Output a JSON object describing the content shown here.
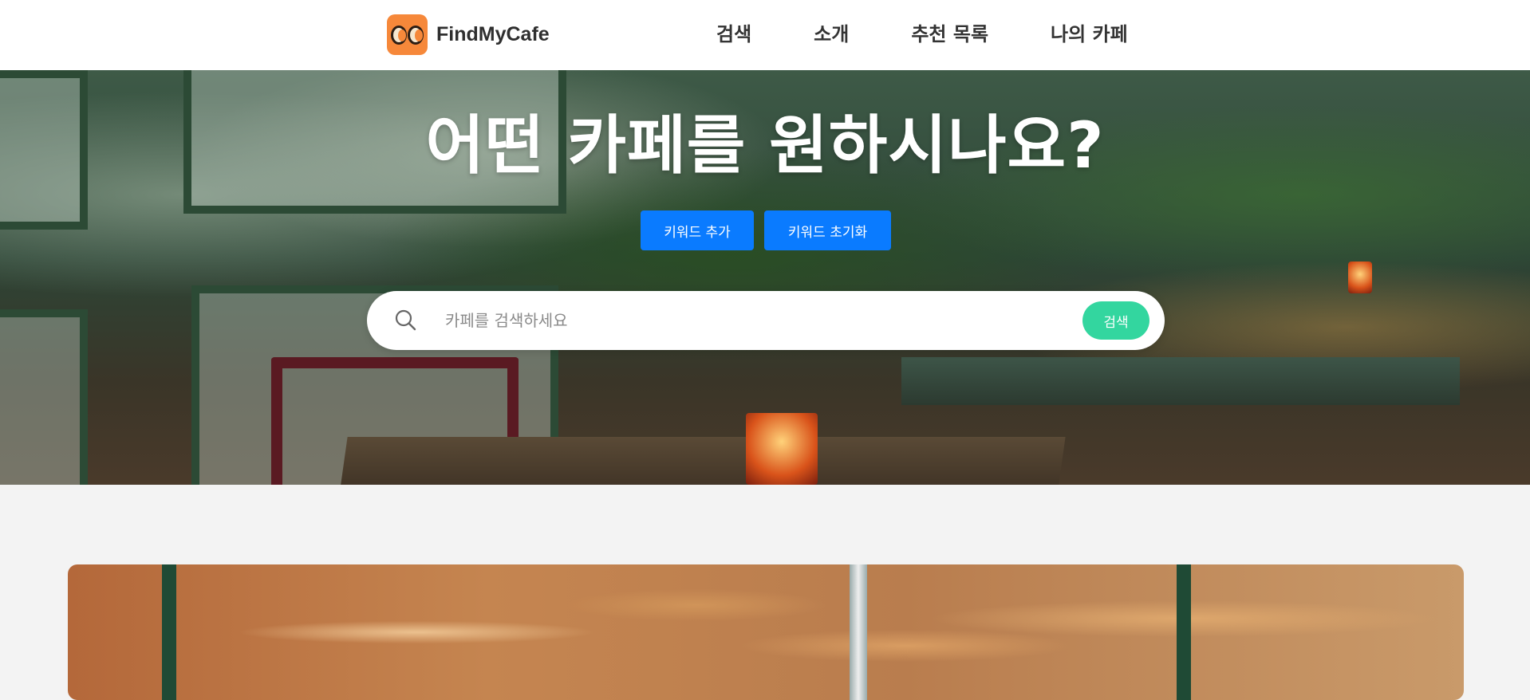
{
  "header": {
    "logo_text": "FindMyCafe",
    "nav": [
      "검색",
      "소개",
      "추천 목록",
      "나의 카페"
    ]
  },
  "hero": {
    "title": "어떤 카페를 원하시나요?",
    "add_keyword_label": "키워드 추가",
    "reset_keyword_label": "키워드 초기화",
    "search": {
      "placeholder": "카페를 검색하세요",
      "button_label": "검색"
    }
  },
  "colors": {
    "primary_blue": "#0a7bff",
    "search_green": "#33d69f",
    "logo_orange": "#f6883a",
    "page_bg": "#f3f3f3"
  },
  "icons": {
    "logo": "coffee-cups-icon",
    "search": "search-icon"
  }
}
